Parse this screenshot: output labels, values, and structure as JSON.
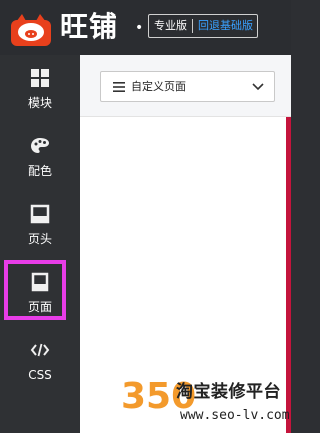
{
  "header": {
    "brand": "旺铺",
    "dot": "•",
    "edition_label": "专业版",
    "switch_back_label": "回退基础版"
  },
  "sidebar": {
    "items": [
      {
        "label": "模块",
        "icon": "grid-icon"
      },
      {
        "label": "配色",
        "icon": "palette-icon"
      },
      {
        "label": "页头",
        "icon": "page-header-icon"
      },
      {
        "label": "页面",
        "icon": "page-icon"
      },
      {
        "label": "CSS",
        "icon": "code-icon"
      }
    ]
  },
  "toolbar": {
    "page_select_value": "自定义页面"
  },
  "watermark": {
    "number": "350",
    "title": "淘宝装修平台",
    "url": "www.seo-lv.com"
  },
  "colors": {
    "highlight": "#e83de8",
    "accent_red": "#c4143c",
    "link_blue": "#39a1ff"
  }
}
